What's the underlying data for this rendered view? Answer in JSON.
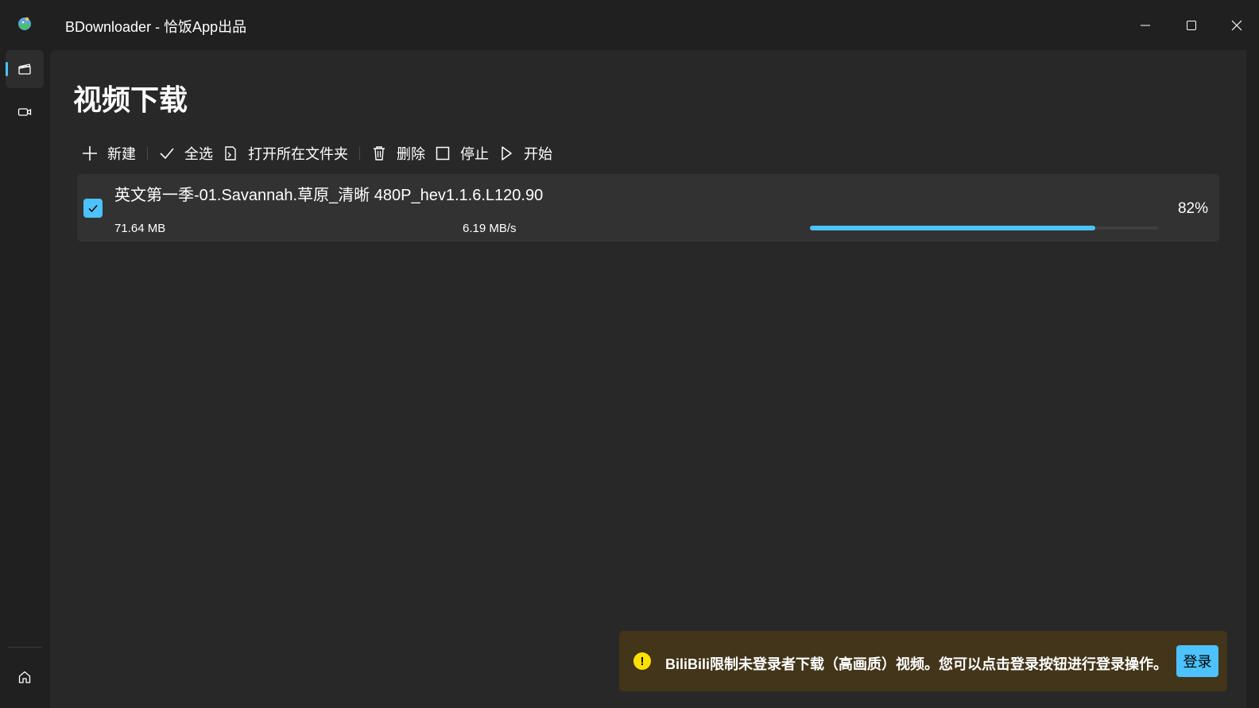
{
  "window": {
    "title": "BDownloader - 恰饭App出品"
  },
  "page": {
    "title": "视频下载"
  },
  "toolbar": {
    "new_label": "新建",
    "select_all_label": "全选",
    "open_folder_label": "打开所在文件夹",
    "delete_label": "删除",
    "stop_label": "停止",
    "start_label": "开始"
  },
  "downloads": [
    {
      "name": "英文第一季-01.Savannah.草原_清晰 480P_hev1.1.6.L120.90",
      "size": "71.64 MB",
      "speed": "6.19 MB/s",
      "percent": "82%",
      "progress": 0.82,
      "checked": true
    }
  ],
  "infobar": {
    "severity": "warning",
    "message": "BiliBili限制未登录者下载（高画质）视频。您可以点击登录按钮进行登录操作。",
    "action_label": "登录"
  },
  "colors": {
    "accent": "#4cc2ff",
    "background": "#202020",
    "content": "#282828",
    "warning_bg": "#433519",
    "warning_icon": "#fce100"
  },
  "icons": {
    "app": "app-logo-icon",
    "nav": [
      "clapperboard-icon",
      "video-camera-icon",
      "home-icon"
    ]
  }
}
